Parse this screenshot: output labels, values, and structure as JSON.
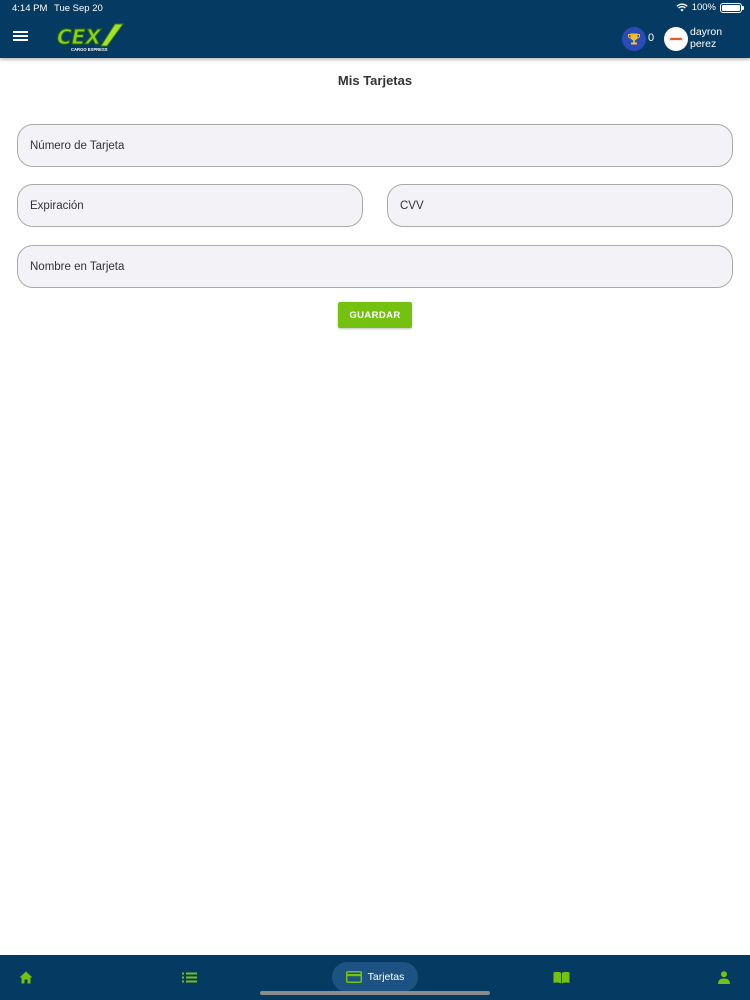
{
  "status_bar": {
    "time": "4:14 PM",
    "date": "Tue Sep 20",
    "battery": "100%",
    "icons": [
      "wifi-icon",
      "battery-icon"
    ]
  },
  "header": {
    "menu_icon": "hamburger-menu-icon",
    "logo_text": "CEX",
    "logo_subtitle": "CARGO EXPRESS",
    "trophy_icon": "trophy-icon",
    "points": "0",
    "user_first": "dayron",
    "user_last": "perez"
  },
  "page": {
    "title": "Mis Tarjetas"
  },
  "form": {
    "card_number_placeholder": "Número de Tarjeta",
    "expiration_placeholder": "Expiración",
    "cvv_placeholder": "CVV",
    "card_name_placeholder": "Nombre en Tarjeta",
    "save_label": "GUARDAR"
  },
  "bottom_nav": {
    "items": [
      {
        "icon": "home-icon",
        "label": ""
      },
      {
        "icon": "list-icon",
        "label": ""
      },
      {
        "icon": "credit-card-icon",
        "label": "Tarjetas",
        "active": true
      },
      {
        "icon": "book-icon",
        "label": ""
      },
      {
        "icon": "person-icon",
        "label": ""
      }
    ]
  },
  "colors": {
    "navy": "#053a63",
    "active_pill": "#1c5382",
    "accent_green": "#74c20f",
    "trophy_badge": "#2c4ab8",
    "field_bg": "#f3f2f6",
    "field_border": "#a9a9a9"
  }
}
